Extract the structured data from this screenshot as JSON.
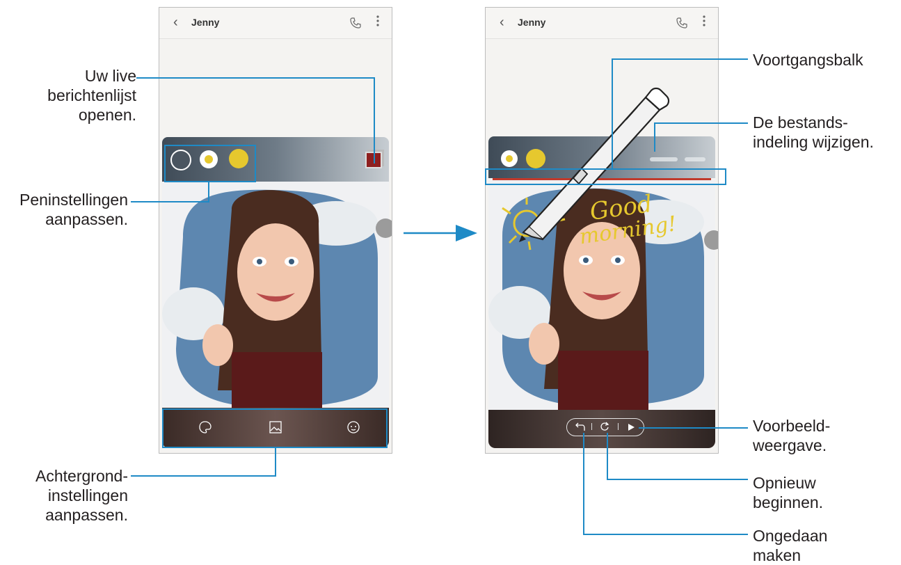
{
  "contact_name": "Jenny",
  "callouts": {
    "live_list": [
      "Uw live",
      "berichtenlijst",
      "openen."
    ],
    "pen_settings": [
      "Peninstellingen",
      "aanpassen."
    ],
    "background_settings": [
      "Achtergrond-",
      "instellingen",
      "aanpassen."
    ],
    "progress_bar": [
      "Voortgangsbalk"
    ],
    "file_format": [
      "De bestands-",
      "indeling wijzigen."
    ],
    "preview": [
      "Voorbeeld-",
      "weergave."
    ],
    "restart": [
      "Opnieuw",
      "beginnen."
    ],
    "undo": [
      "Ongedaan",
      "maken"
    ]
  },
  "handwriting": [
    "Good",
    "morning!"
  ],
  "colors": {
    "accent": "#1e8ac6",
    "pen_yellow": "#e6c82e",
    "sky": "#5d87b0",
    "shirt": "#5a1a1a"
  },
  "icons": {
    "back": "chevron-left-icon",
    "call": "phone-icon",
    "more": "more-vertical-icon",
    "live_list": "live-message-list-icon",
    "palette": "palette-icon",
    "image": "image-icon",
    "avatar": "emoji-face-icon",
    "undo": "undo-icon",
    "restart": "restart-icon",
    "play": "play-icon",
    "pen": "pen-edit-icon"
  }
}
